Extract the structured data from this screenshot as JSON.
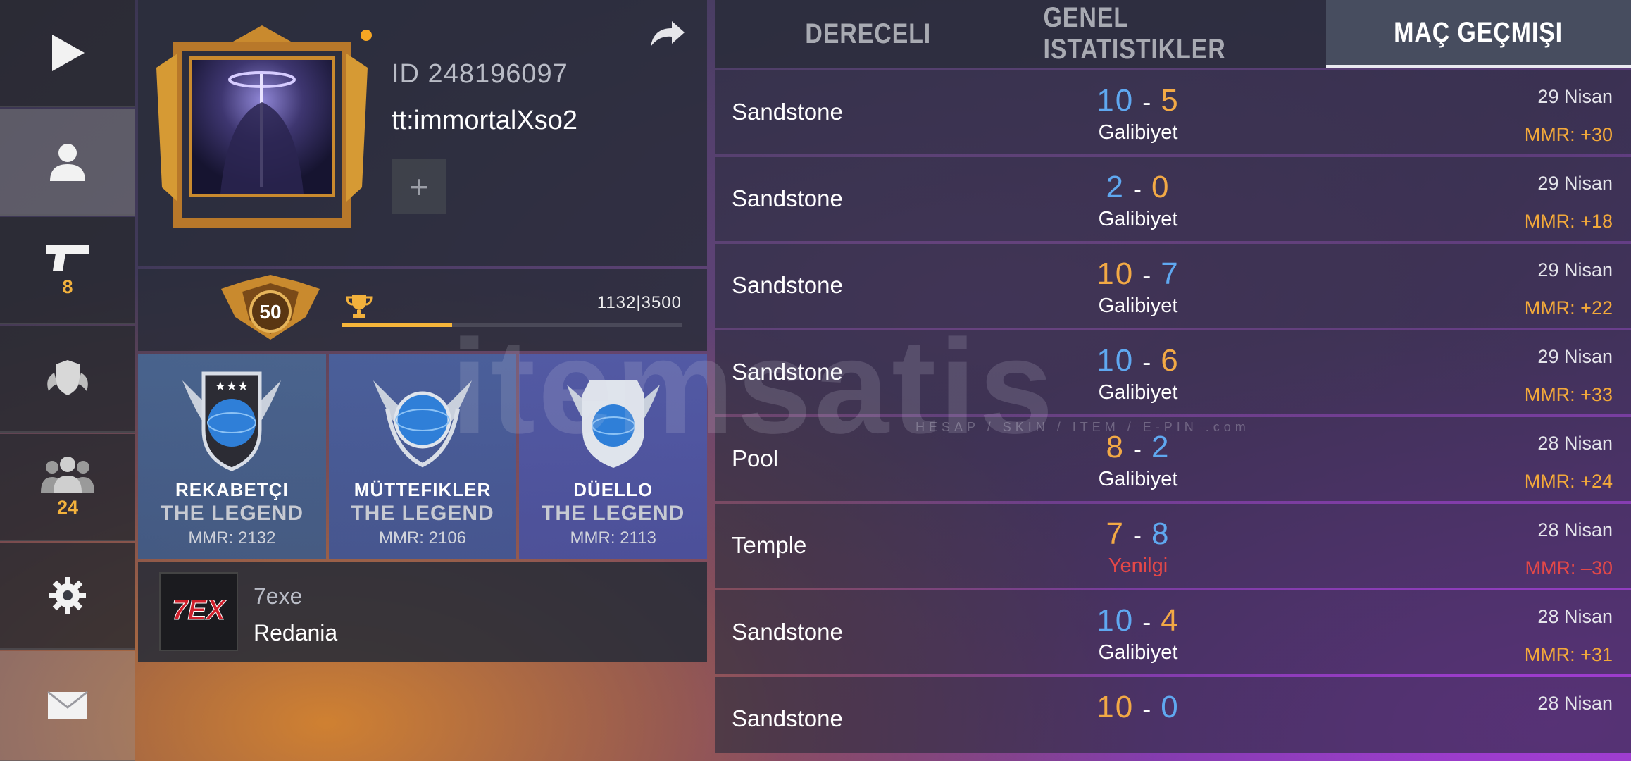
{
  "sidebar": {
    "items": [
      {
        "name": "play",
        "icon": "play-icon"
      },
      {
        "name": "profile",
        "icon": "person-icon",
        "active": true
      },
      {
        "name": "weapons",
        "icon": "pistol-icon",
        "count": "8"
      },
      {
        "name": "clan",
        "icon": "shield-wings-icon"
      },
      {
        "name": "friends",
        "icon": "group-icon",
        "count": "24"
      },
      {
        "name": "settings",
        "icon": "gear-icon"
      },
      {
        "name": "mail",
        "icon": "envelope-icon"
      }
    ]
  },
  "profile": {
    "id_label": "ID 248196097",
    "name": "tt:immortalXso2",
    "add_label": "+",
    "level": "50",
    "xp_text": "1132|3500",
    "xp_fraction": 0.323
  },
  "ranks": [
    {
      "title": "REKABETÇI",
      "tier": "THE LEGEND",
      "mmr": "MMR: 2132"
    },
    {
      "title": "MÜTTEFIKLER",
      "tier": "THE LEGEND",
      "mmr": "MMR: 2106"
    },
    {
      "title": "DÜELLO",
      "tier": "THE LEGEND",
      "mmr": "MMR: 2113"
    }
  ],
  "clan": {
    "tag": "7exe",
    "server": "Redania",
    "logo_text": "7EX"
  },
  "tabs": [
    {
      "label": "DERECELI",
      "active": false
    },
    {
      "label": "GENEL ISTATISTIKLER",
      "active": false
    },
    {
      "label": "MAÇ GEÇMIŞI",
      "active": true
    }
  ],
  "matches": [
    {
      "map": "Sandstone",
      "score_a": "10",
      "score_b": "5",
      "color_a": "blue",
      "color_b": "orange",
      "result": "Galibiyet",
      "loss": false,
      "date": "29 Nisan",
      "mmr": "MMR: +30"
    },
    {
      "map": "Sandstone",
      "score_a": "2",
      "score_b": "0",
      "color_a": "blue",
      "color_b": "orange",
      "result": "Galibiyet",
      "loss": false,
      "date": "29 Nisan",
      "mmr": "MMR: +18"
    },
    {
      "map": "Sandstone",
      "score_a": "10",
      "score_b": "7",
      "color_a": "orange",
      "color_b": "blue",
      "result": "Galibiyet",
      "loss": false,
      "date": "29 Nisan",
      "mmr": "MMR: +22"
    },
    {
      "map": "Sandstone",
      "score_a": "10",
      "score_b": "6",
      "color_a": "blue",
      "color_b": "orange",
      "result": "Galibiyet",
      "loss": false,
      "date": "29 Nisan",
      "mmr": "MMR: +33"
    },
    {
      "map": "Pool",
      "score_a": "8",
      "score_b": "2",
      "color_a": "orange",
      "color_b": "blue",
      "result": "Galibiyet",
      "loss": false,
      "date": "28 Nisan",
      "mmr": "MMR: +24"
    },
    {
      "map": "Temple",
      "score_a": "7",
      "score_b": "8",
      "color_a": "orange",
      "color_b": "blue",
      "result": "Yenilgi",
      "loss": true,
      "date": "28 Nisan",
      "mmr": "MMR: –30"
    },
    {
      "map": "Sandstone",
      "score_a": "10",
      "score_b": "4",
      "color_a": "blue",
      "color_b": "orange",
      "result": "Galibiyet",
      "loss": false,
      "date": "28 Nisan",
      "mmr": "MMR: +31"
    },
    {
      "map": "Sandstone",
      "score_a": "10",
      "score_b": "0",
      "color_a": "orange",
      "color_b": "blue",
      "result": "",
      "loss": false,
      "date": "28 Nisan",
      "mmr": ""
    }
  ],
  "score_dash": "-",
  "watermark": {
    "text": "itemsatis",
    "sub": "HESAP / SKIN / ITEM / E-PIN .com"
  },
  "colors": {
    "blue": "#5fa8f0",
    "orange": "#f2a945",
    "loss_red": "#e34848",
    "mmr_gain": "#f3a93a",
    "count_yellow": "#f3b23c"
  }
}
